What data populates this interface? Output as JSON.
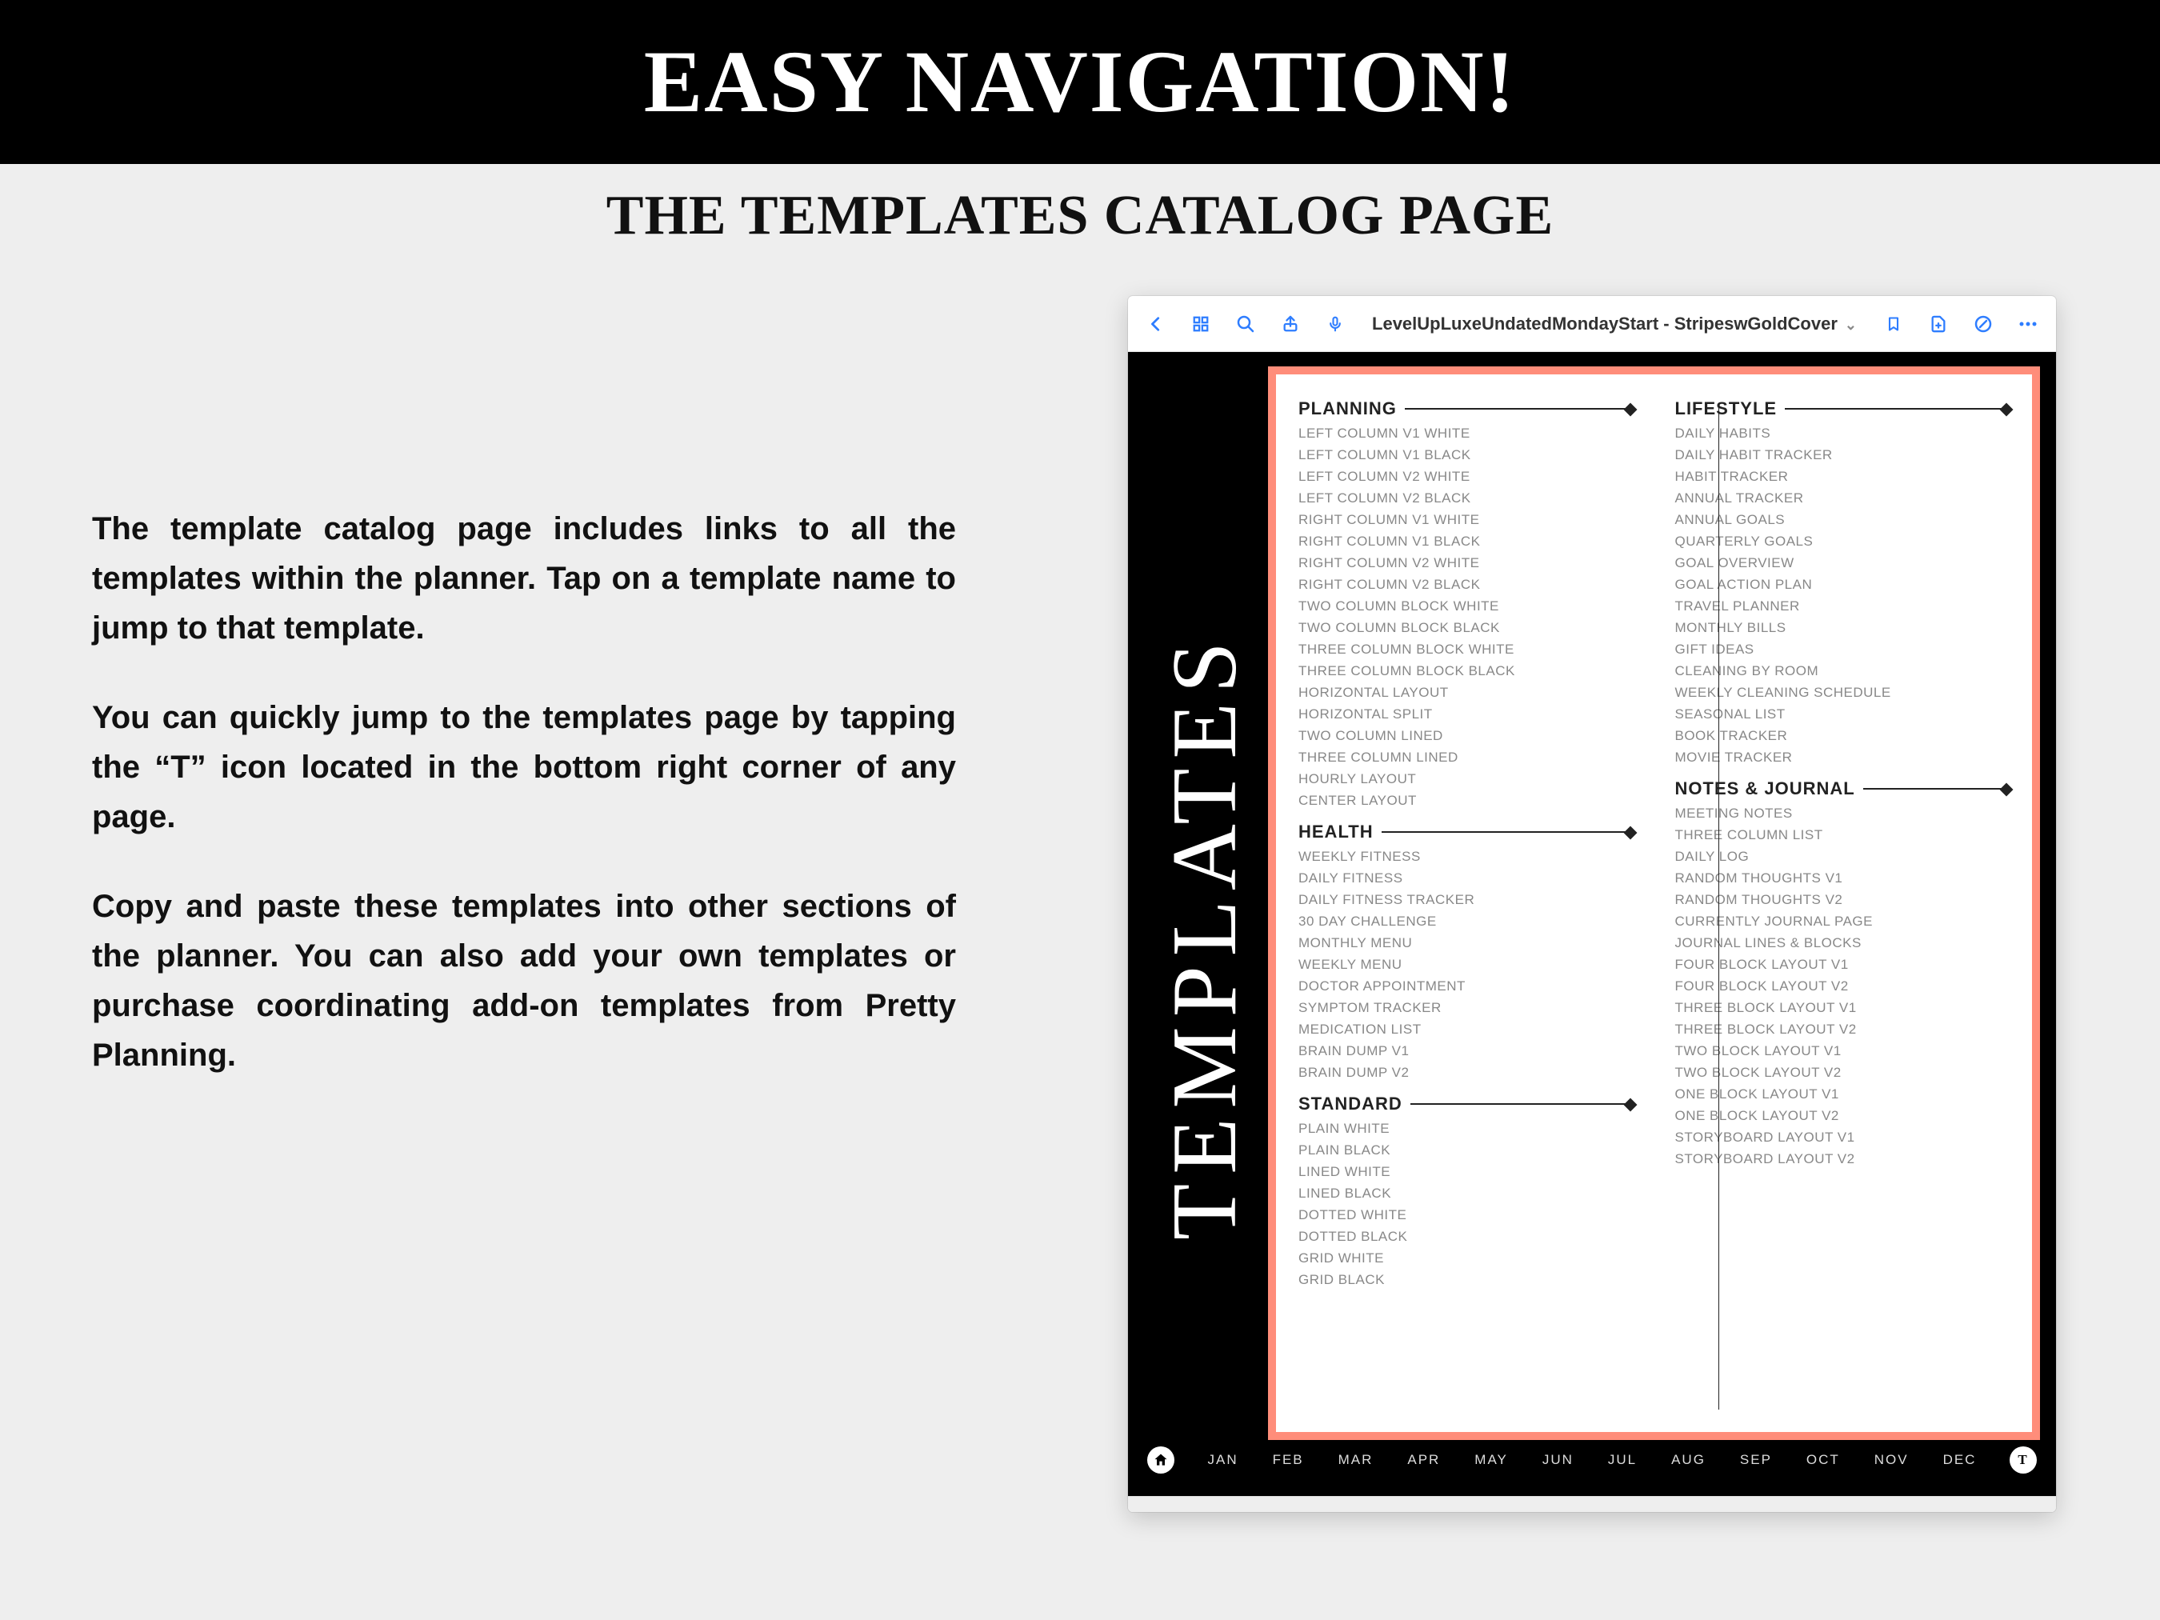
{
  "banner_title": "EASY NAVIGATION!",
  "subtitle": "THE TEMPLATES CATALOG PAGE",
  "explainer": {
    "p1": "The template catalog page includes links to all the templates within the planner. Tap on a template name to jump to that template.",
    "p2": "You can quickly jump to the templates page by tapping the “T” icon located in the bottom right corner of any page.",
    "p3": "Copy and paste these templates into other sections of the planner. You can also add your own templates or purchase coordinating add-on templates from Pretty Planning."
  },
  "toolbar": {
    "doc_title": "LevelUpLuxeUndatedMondayStart - StripeswGoldCover"
  },
  "sidebar_label": "TEMPLATES",
  "sections": {
    "planning": {
      "title": "PLANNING",
      "items": [
        "LEFT COLUMN V1 WHITE",
        "LEFT COLUMN V1 BLACK",
        "LEFT COLUMN V2 WHITE",
        "LEFT COLUMN V2 BLACK",
        "RIGHT COLUMN V1 WHITE",
        "RIGHT COLUMN V1 BLACK",
        "RIGHT COLUMN V2 WHITE",
        "RIGHT COLUMN V2 BLACK",
        "TWO COLUMN BLOCK WHITE",
        "TWO COLUMN BLOCK BLACK",
        "THREE COLUMN BLOCK WHITE",
        "THREE COLUMN BLOCK BLACK",
        "HORIZONTAL LAYOUT",
        "HORIZONTAL SPLIT",
        "TWO COLUMN LINED",
        "THREE COLUMN LINED",
        "HOURLY LAYOUT",
        "CENTER LAYOUT"
      ]
    },
    "health": {
      "title": "HEALTH",
      "items": [
        "WEEKLY FITNESS",
        "DAILY FITNESS",
        "DAILY FITNESS TRACKER",
        "30 DAY CHALLENGE",
        "MONTHLY MENU",
        "WEEKLY MENU",
        "DOCTOR APPOINTMENT",
        "SYMPTOM TRACKER",
        "MEDICATION LIST",
        "BRAIN DUMP V1",
        "BRAIN DUMP V2"
      ]
    },
    "standard": {
      "title": "STANDARD",
      "items": [
        "PLAIN WHITE",
        "PLAIN BLACK",
        "LINED WHITE",
        "LINED BLACK",
        "DOTTED WHITE",
        "DOTTED BLACK",
        "GRID WHITE",
        "GRID BLACK"
      ]
    },
    "lifestyle": {
      "title": "LIFESTYLE",
      "items": [
        "DAILY HABITS",
        "DAILY HABIT TRACKER",
        "HABIT TRACKER",
        "ANNUAL TRACKER",
        "ANNUAL GOALS",
        "QUARTERLY GOALS",
        "GOAL OVERVIEW",
        "GOAL ACTION PLAN",
        "TRAVEL PLANNER",
        "MONTHLY BILLS",
        "GIFT IDEAS",
        "CLEANING BY ROOM",
        "WEEKLY CLEANING SCHEDULE",
        "SEASONAL LIST",
        "BOOK TRACKER",
        "MOVIE TRACKER"
      ]
    },
    "notes": {
      "title": "NOTES & JOURNAL",
      "items": [
        "MEETING NOTES",
        "THREE COLUMN LIST",
        "DAILY LOG",
        "RANDOM THOUGHTS V1",
        "RANDOM THOUGHTS V2",
        "CURRENTLY JOURNAL PAGE",
        "JOURNAL LINES & BLOCKS",
        "FOUR BLOCK LAYOUT V1",
        "FOUR BLOCK LAYOUT V2",
        "THREE BLOCK LAYOUT V1",
        "THREE BLOCK LAYOUT V2",
        "TWO BLOCK LAYOUT V1",
        "TWO BLOCK LAYOUT V2",
        "ONE BLOCK LAYOUT V1",
        "ONE BLOCK LAYOUT V2",
        "STORYBOARD LAYOUT V1",
        "STORYBOARD LAYOUT V2"
      ]
    }
  },
  "months": [
    "JAN",
    "FEB",
    "MAR",
    "APR",
    "MAY",
    "JUN",
    "JUL",
    "AUG",
    "SEP",
    "OCT",
    "NOV",
    "DEC"
  ],
  "t_icon": "T"
}
